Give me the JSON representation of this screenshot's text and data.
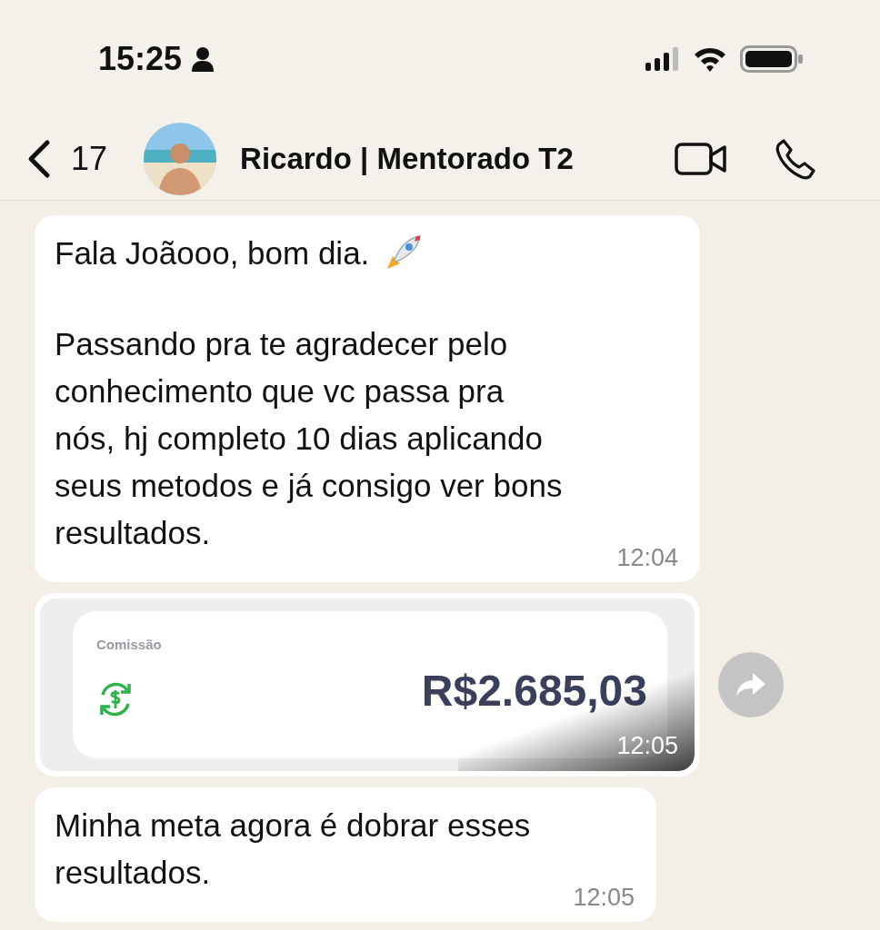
{
  "status_bar": {
    "time": "15:25"
  },
  "header": {
    "back_count": "17",
    "contact_name": "Ricardo | Mentorado T2"
  },
  "messages": [
    {
      "kind": "text",
      "text": "Fala Joãooo, bom dia.",
      "body": "Passando pra te agradecer pelo\nconhecimento que vc passa pra\nnós, hj completo 10 dias aplicando\nseus metodos e já consigo ver bons\nresultados.",
      "time": "12:04"
    },
    {
      "label": "Comissão",
      "amount": "R$2.685,03",
      "time": "12:05"
    },
    {
      "kind": "text",
      "body": "Minha meta agora é dobrar esses\nresultados.",
      "time": "12:05"
    }
  ]
}
